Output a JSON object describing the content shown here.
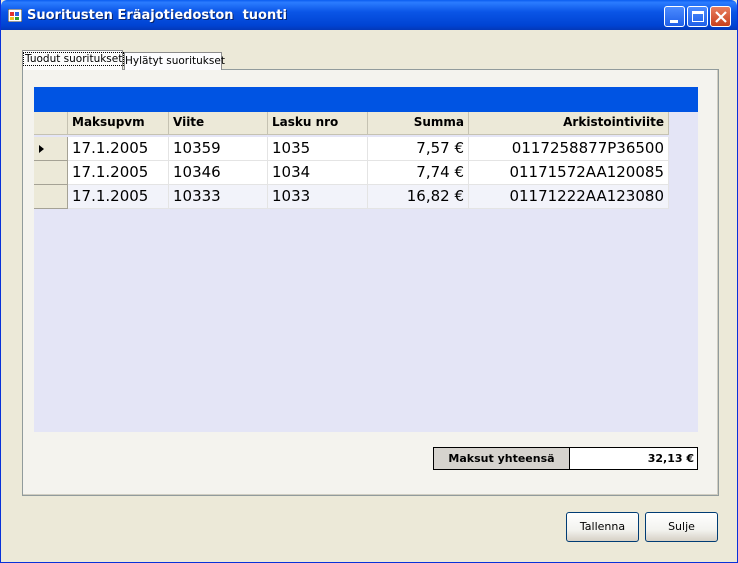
{
  "window": {
    "title": "Suoritusten Eräajotiedoston  tuonti"
  },
  "tabs": [
    {
      "label": "Tuodut suoritukset",
      "active": true
    },
    {
      "label": "Hylätyt suoritukset",
      "active": false
    }
  ],
  "grid": {
    "columns": [
      {
        "label": "Maksupvm",
        "align": "left"
      },
      {
        "label": "Viite",
        "align": "left"
      },
      {
        "label": "Lasku nro",
        "align": "left"
      },
      {
        "label": "Summa",
        "align": "right"
      },
      {
        "label": "Arkistointiviite",
        "align": "right"
      }
    ],
    "rows": [
      [
        "17.1.2005",
        "10359",
        "1035",
        "7,57 €",
        "0117258877P36500"
      ],
      [
        "17.1.2005",
        "10346",
        "1034",
        "7,74 €",
        "01171572AA120085"
      ],
      [
        "17.1.2005",
        "10333",
        "1033",
        "16,82 €",
        "01171222AA123080"
      ]
    ],
    "current_row": 0
  },
  "totals": {
    "label": "Maksut yhteensä",
    "value": "32,13 €"
  },
  "buttons": {
    "save": "Tallenna",
    "close": "Sulje"
  },
  "colors": {
    "titlebar": "#0054e3",
    "grid_caption": "#0054e3",
    "grid_background": "#e4e5f6"
  }
}
